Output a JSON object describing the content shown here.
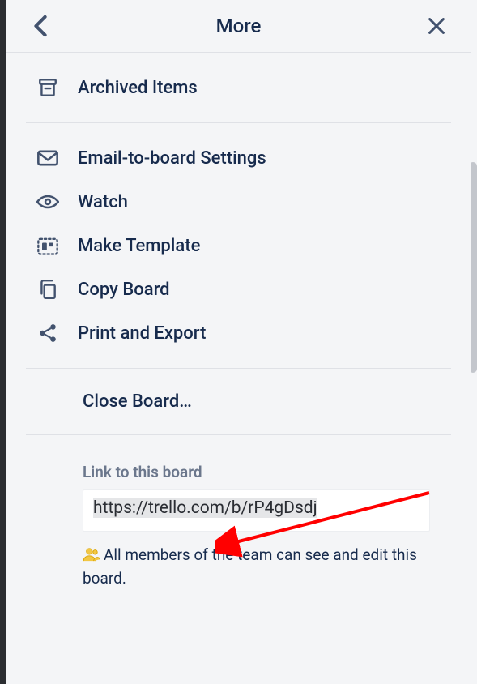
{
  "header": {
    "title": "More"
  },
  "items": {
    "archived": {
      "label": "Archived Items"
    },
    "email": {
      "label": "Email-to-board Settings"
    },
    "watch": {
      "label": "Watch"
    },
    "template": {
      "label": "Make Template"
    },
    "copy": {
      "label": "Copy Board"
    },
    "print": {
      "label": "Print and Export"
    },
    "close": {
      "label": "Close Board…"
    }
  },
  "link": {
    "label": "Link to this board",
    "url": "https://trello.com/b/rP4gDsdj",
    "note": "All members of the team can see and edit this board."
  }
}
